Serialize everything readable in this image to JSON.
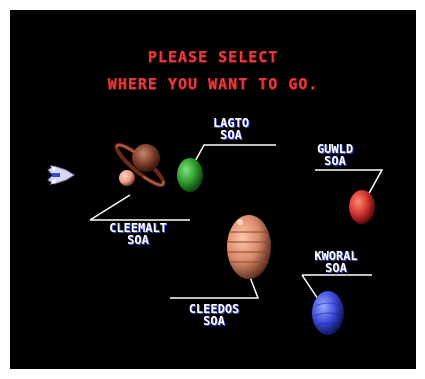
{
  "prompt": {
    "line1": "PLEASE SELECT",
    "line2": "WHERE YOU WANT TO GO."
  },
  "destinations": {
    "lagto": {
      "name": "LAGTO",
      "suffix": "SOA",
      "color": "#2a9a2a"
    },
    "guwld": {
      "name": "GUWLD",
      "suffix": "SOA",
      "color": "#d03030"
    },
    "cleemalt": {
      "name": "CLEEMALT",
      "suffix": "SOA",
      "color": "#8a4a3a"
    },
    "kworal": {
      "name": "KWORAL",
      "suffix": "SOA",
      "color": "#3a4ad8"
    },
    "cleedos": {
      "name": "CLEEDOS",
      "suffix": "SOA",
      "color": "#d88a6a"
    }
  },
  "cursor": {
    "icon": "ship-cursor-icon"
  }
}
